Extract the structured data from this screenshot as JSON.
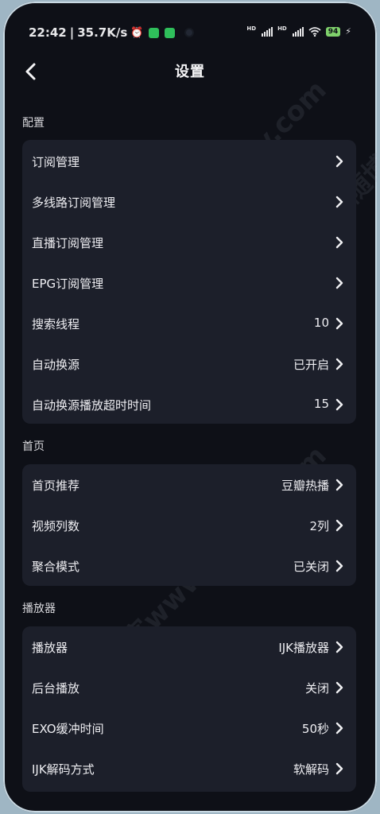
{
  "status": {
    "time": "22:42",
    "speed": "35.7K/s",
    "hd1": "HD",
    "hd2": "HD",
    "battery": "94"
  },
  "header": {
    "title": "设置"
  },
  "sections": [
    {
      "label": "配置",
      "items": [
        {
          "label": "订阅管理",
          "value": ""
        },
        {
          "label": "多线路订阅管理",
          "value": ""
        },
        {
          "label": "直播订阅管理",
          "value": ""
        },
        {
          "label": "EPG订阅管理",
          "value": ""
        },
        {
          "label": "搜索线程",
          "value": "10"
        },
        {
          "label": "自动换源",
          "value": "已开启"
        },
        {
          "label": "自动换源播放超时时间",
          "value": "15"
        }
      ]
    },
    {
      "label": "首页",
      "items": [
        {
          "label": "首页推荐",
          "value": "豆瓣热播"
        },
        {
          "label": "视频列数",
          "value": "2列"
        },
        {
          "label": "聚合模式",
          "value": "已关闭"
        }
      ]
    },
    {
      "label": "播放器",
      "items": [
        {
          "label": "播放器",
          "value": "IJK播放器"
        },
        {
          "label": "后台播放",
          "value": "关闭"
        },
        {
          "label": "EXO缓冲时间",
          "value": "50秒"
        },
        {
          "label": "IJK解码方式",
          "value": "软解码"
        }
      ]
    }
  ],
  "watermarks": [
    "一生相随博客www.520xv.com",
    "一生相随博客www.520xv.com",
    "一生相随博客"
  ]
}
